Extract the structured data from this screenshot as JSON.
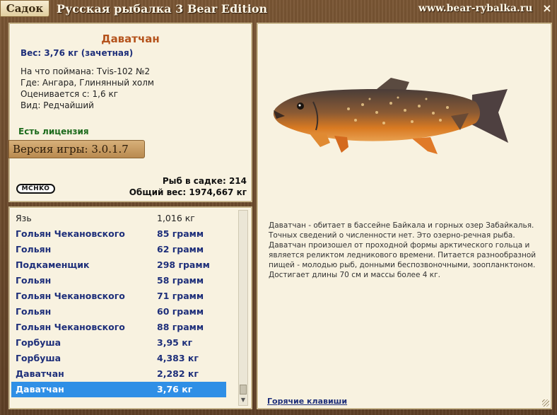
{
  "window": {
    "tab_label": "Садок",
    "title": "Русская рыбалка 3 Bear Edition",
    "site": "www.bear-rybalka.ru",
    "close_glyph": "×"
  },
  "fish_info": {
    "name": "Даватчан",
    "weight": "Вес: 3,76 кг (зачетная)",
    "caught_with_label": "На что поймана:",
    "caught_with": "Tvis-102 №2",
    "location_label": "Где:",
    "location": "Ангара, Глинянный холм",
    "value_label": "Оценивается с:",
    "value": "1,6 кг",
    "kind_label": "Вид:",
    "kind": "Редчайший",
    "license": "Есть лицензия",
    "version": "Версия игры: 3.0.1.7",
    "logo_text": "MCHKO",
    "fish_count": "Рыб в садке: 214",
    "total_weight": "Общий вес: 1974,667 кг"
  },
  "catch_list": [
    {
      "name": "Язь",
      "weight": "1,016 кг",
      "style": "plain"
    },
    {
      "name": "Гольян Чекановского",
      "weight": "85 грамм",
      "style": "bold"
    },
    {
      "name": "Гольян",
      "weight": "62 грамм",
      "style": "bold"
    },
    {
      "name": "Подкаменщик",
      "weight": "298 грамм",
      "style": "bold"
    },
    {
      "name": "Гольян",
      "weight": "58 грамм",
      "style": "bold"
    },
    {
      "name": "Гольян Чекановского",
      "weight": "71 грамм",
      "style": "bold"
    },
    {
      "name": "Гольян",
      "weight": "60 грамм",
      "style": "bold"
    },
    {
      "name": "Гольян Чекановского",
      "weight": "88 грамм",
      "style": "bold"
    },
    {
      "name": "Горбуша",
      "weight": "3,95 кг",
      "style": "bold"
    },
    {
      "name": "Горбуша",
      "weight": "4,383 кг",
      "style": "bold"
    },
    {
      "name": "Даватчан",
      "weight": "2,282 кг",
      "style": "bold"
    },
    {
      "name": "Даватчан",
      "weight": "3,76 кг",
      "style": "selected"
    }
  ],
  "description": "Даватчан - обитает в бассейне Байкала и горных озер Забайкалья. Точных сведений о численности нет. Это озерно-речная рыба. Даватчан произошел от проходной формы арктического гольца и является реликтом ледникового времени. Питается разнообразной пищей - молодью рыб, донными беспозвоночными, зоопланктоном. Достигает длины 70 см и массы более 4 кг.",
  "hotkeys_link": "Горячие клавиши",
  "icons": {
    "close": "close-icon",
    "scroll_down": "chevron-down-icon",
    "fish": "fish-illustration"
  },
  "colors": {
    "accent_name": "#b5531c",
    "list_text": "#1e2f7a",
    "selection": "#2f8fe6",
    "license": "#1d6b1d"
  }
}
